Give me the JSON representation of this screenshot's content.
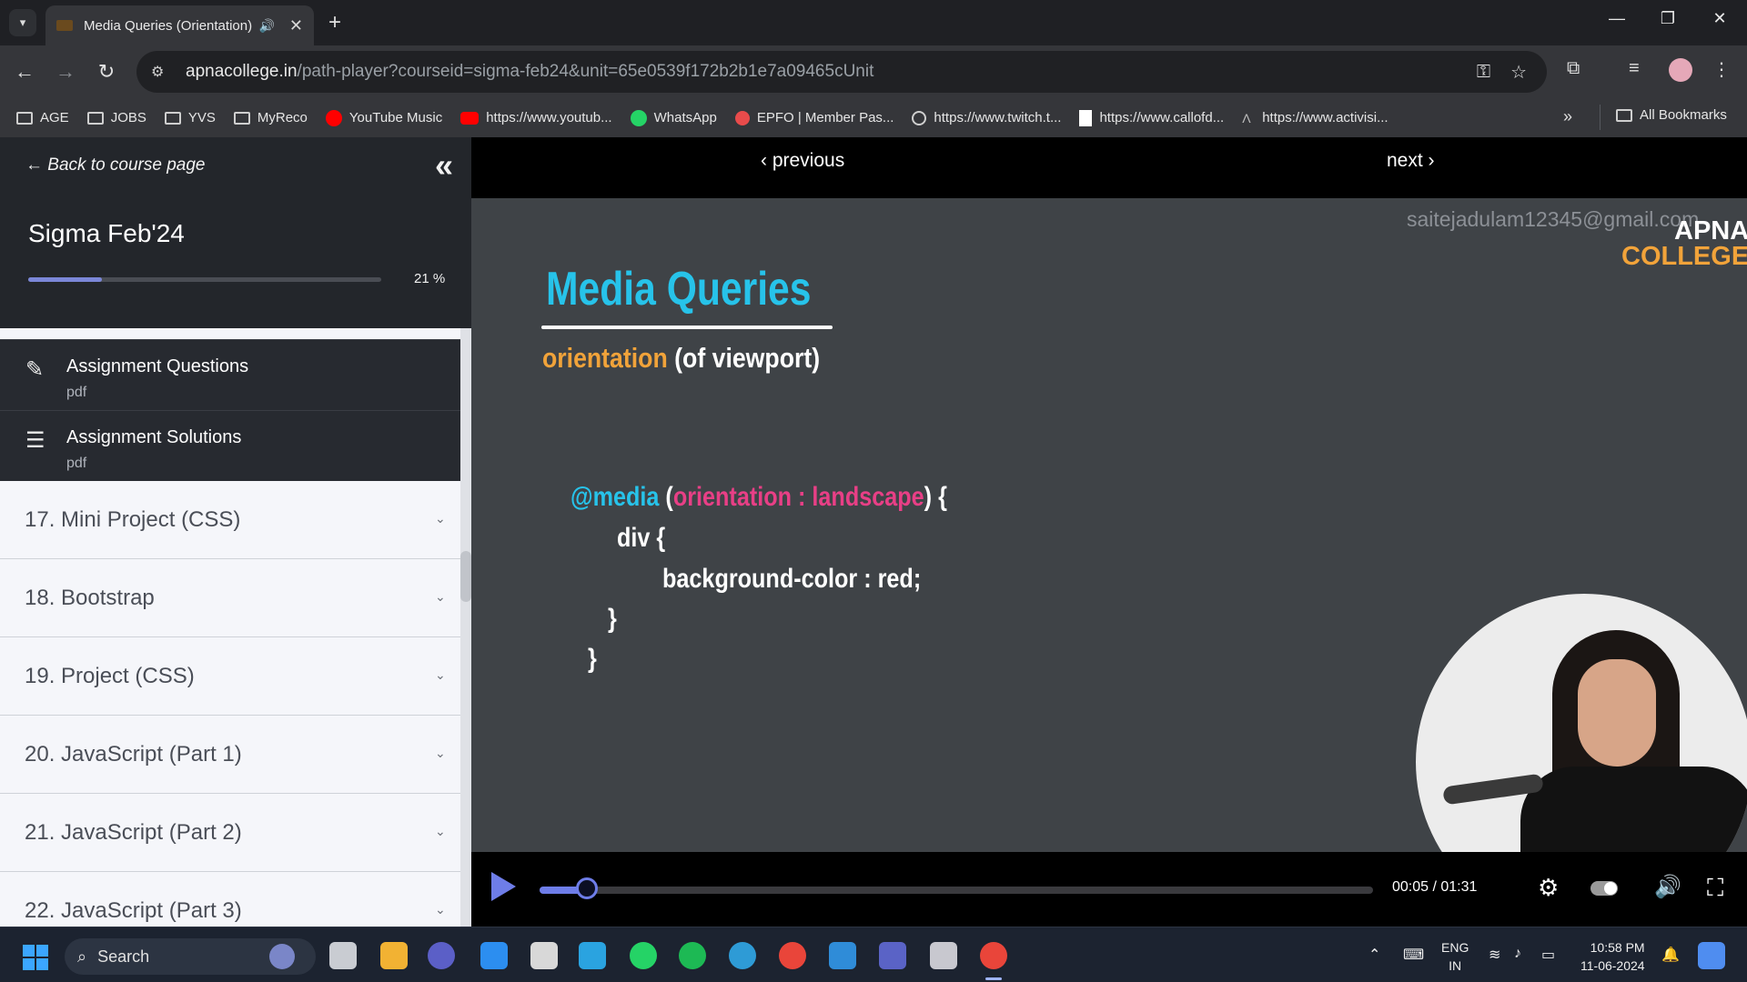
{
  "browser": {
    "tab_title": "Media Queries (Orientation)",
    "url_host": "apnacollege.in",
    "url_path": "/path-player?courseid=sigma-feb24&unit=65e0539f172b2b1e7a09465cUnit",
    "bookmarks": [
      {
        "label": "AGE",
        "icon": "folder-icon"
      },
      {
        "label": "JOBS",
        "icon": "folder-icon"
      },
      {
        "label": "YVS",
        "icon": "folder-icon"
      },
      {
        "label": "MyReco",
        "icon": "folder-icon"
      },
      {
        "label": "YouTube Music",
        "icon": "youtube-music-icon"
      },
      {
        "label": "https://www.youtub...",
        "icon": "youtube-icon"
      },
      {
        "label": "WhatsApp",
        "icon": "whatsapp-icon"
      },
      {
        "label": "EPFO | Member Pas...",
        "icon": "epfo-icon"
      },
      {
        "label": "https://www.twitch.t...",
        "icon": "globe-icon"
      },
      {
        "label": "https://www.callofd...",
        "icon": "callofduty-icon"
      },
      {
        "label": "https://www.activisi...",
        "icon": "activision-icon"
      }
    ],
    "all_bookmarks_label": "All Bookmarks"
  },
  "sidebar": {
    "back_label": "← Back to course page",
    "course_title": "Sigma Feb'24",
    "progress_percent": 21,
    "progress_label": "21 %",
    "resources": [
      {
        "title": "Assignment Questions",
        "type": "pdf",
        "icon": "assignment-edit-icon"
      },
      {
        "title": "Assignment Solutions",
        "type": "pdf",
        "icon": "checklist-icon"
      }
    ],
    "sections": [
      "17. Mini Project (CSS)",
      "18. Bootstrap",
      "19. Project (CSS)",
      "20. JavaScript (Part 1)",
      "21. JavaScript (Part 2)",
      "22. JavaScript (Part 3)"
    ]
  },
  "player": {
    "previous_label": "previous",
    "next_label": "next",
    "watermark": "saitejadulam12345@gmail.com",
    "brand_top": "APNA",
    "brand_bottom": "COLLEGE",
    "slide_title": "Media Queries",
    "subtitle_highlight": "orientation",
    "subtitle_rest": "(of viewport)",
    "code_line1_at": "@media",
    "code_line1_open": "(",
    "code_line1_cond": "orientation : landscape",
    "code_line1_close": ") {",
    "code_line2": "div {",
    "code_line3": "background-color : red;",
    "code_line4": "}",
    "code_line5": "}",
    "time_label": "00:05 / 01:31",
    "progress_fraction": 0.057
  },
  "taskbar": {
    "search_label": "Search",
    "lang_line1": "ENG",
    "lang_line2": "IN",
    "time": "10:58 PM",
    "date": "11-06-2024"
  },
  "colors": {
    "accent": "#6e7de8",
    "slide_title": "#27c3ea",
    "orange": "#f1a33a",
    "pink": "#e83f86"
  }
}
